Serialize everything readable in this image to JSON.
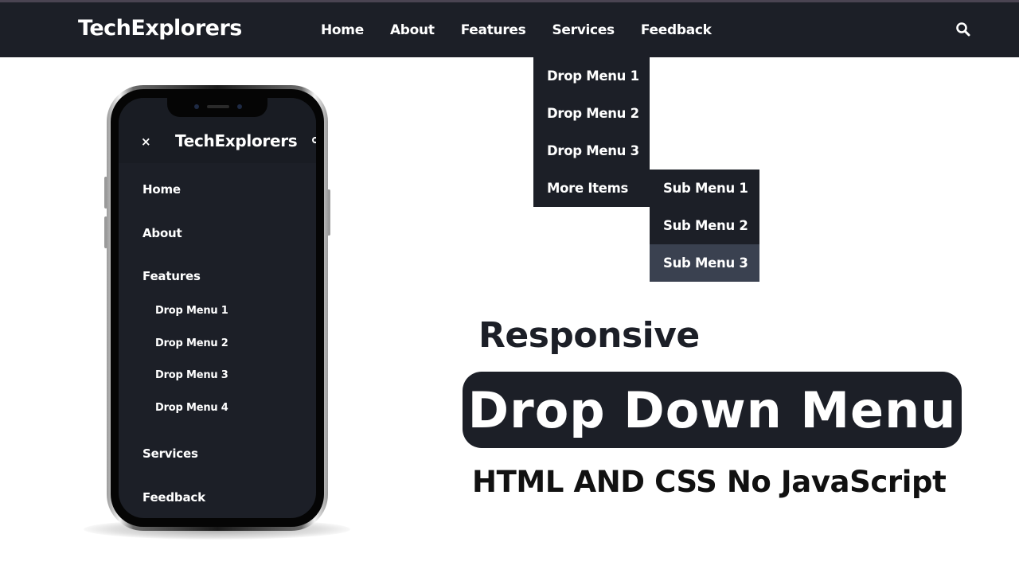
{
  "navbar": {
    "brand": "TechExplorers",
    "links": [
      "Home",
      "About",
      "Features",
      "Services",
      "Feedback"
    ],
    "search_icon": "search-icon"
  },
  "dropdown": {
    "items": [
      "Drop Menu 1",
      "Drop Menu 2",
      "Drop Menu 3",
      "More Items"
    ]
  },
  "submenu": {
    "items": [
      "Sub Menu 1",
      "Sub Menu 2",
      "Sub Menu 3"
    ],
    "active_index": 2
  },
  "mobile": {
    "close_symbol": "×",
    "brand": "TechExplorers",
    "items": [
      "Home",
      "About",
      "Features",
      "Services",
      "Feedback"
    ],
    "sub_items": [
      "Drop Menu 1",
      "Drop Menu 2",
      "Drop Menu 3",
      "Drop Menu 4"
    ]
  },
  "headline": {
    "line1": "Responsive",
    "title": "Drop Down Menu",
    "subtitle": "HTML AND CSS No JavaScript"
  },
  "colors": {
    "dark": "#1c1f27",
    "active_submenu": "#3a4150",
    "topline": "#4a4452"
  }
}
